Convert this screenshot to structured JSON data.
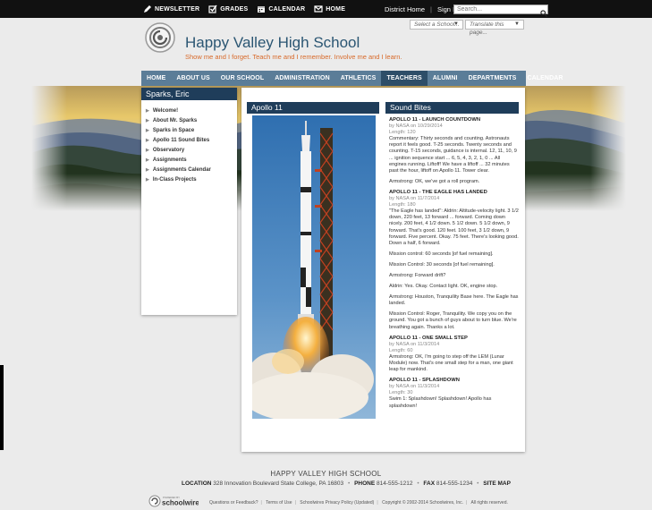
{
  "topbar": {
    "links": [
      {
        "label": "NEWSLETTER",
        "icon": "pencil-icon"
      },
      {
        "label": "GRADES",
        "icon": "checkbox-icon"
      },
      {
        "label": "CALENDAR",
        "icon": "calendar-icon"
      },
      {
        "label": "HOME",
        "icon": "home-icon"
      }
    ],
    "district_home": "District Home",
    "sign_in": "Sign In",
    "search_placeholder": "Search..."
  },
  "selectors": {
    "school": "Select a School...",
    "translate": "Translate this page..."
  },
  "header": {
    "school_name": "Happy Valley High School",
    "tagline": "Show me and I forget. Teach me and I remember. Involve me and I learn."
  },
  "nav": [
    "HOME",
    "ABOUT US",
    "OUR SCHOOL",
    "ADMINISTRATION",
    "ATHLETICS",
    "TEACHERS",
    "ALUMNI",
    "DEPARTMENTS",
    "CALENDAR"
  ],
  "nav_active": "TEACHERS",
  "sidebar": {
    "title": "Sparks, Eric",
    "items": [
      "Welcome!",
      "About Mr. Sparks",
      "Sparks in Space",
      "Apollo 11 Sound Bites",
      "Observatory",
      "Assignments",
      "Assignments Calendar",
      "In-Class Projects"
    ]
  },
  "apollo": {
    "title": "Apollo 11"
  },
  "sound_bites": {
    "title": "Sound Bites",
    "clips": [
      {
        "title": "APOLLO 11 - LAUNCH COUNTDOWN",
        "meta": "by NASA on 10/29/2014",
        "length": "Length: 120",
        "lines": [
          "Commentary: Thirty seconds and counting. Astronauts report it feels good. T-25 seconds. Twenty seconds and counting. T-15 seconds, guidance is internal. 12, 11, 10, 9 ... ignition sequence start ... 6, 5, 4, 3, 2, 1, 0 ... All engines running. Liftoff! We have a liftoff ... 32 minutes past the hour, liftoff on Apollo 11. Tower clear.",
          "Armstrong: OK, we've got a roll program."
        ]
      },
      {
        "title": "APOLLO 11 - THE EAGLE HAS LANDED",
        "meta": "by NASA on 11/7/2014",
        "length": "Length: 180",
        "lines": [
          "\"The Eagle has landed\": Aldrin: Altitude-velocity light. 3 1/2 down, 220 feet, 13 forward ... forward. Coming down nicely. 200 feet, 4 1/2 down. 5 1/2 down. 5 1/2 down, 9 forward. That's good. 120 feet. 100 feet, 3 1/2 down, 9 forward. Five percent. Okay. 75 feet. There's looking good. Down a half, 6 forward.",
          "Mission control: 60 seconds [of fuel remaining].",
          "Mission Control: 30 seconds [of fuel remaining].",
          "Armstrong: Forward drift?",
          "Aldrin: Yes. Okay. Contact light. OK, engine stop.",
          "Armstrong: Houston, Tranquility Base here. The Eagle has landed.",
          "Mission Control: Roger, Tranquility. We copy you on the ground. You got a bunch of guys about to turn blue. We're breathing again. Thanks a lot."
        ]
      },
      {
        "title": "APOLLO 11 - ONE SMALL STEP",
        "meta": "by NASA on 11/3/2014",
        "length": "Length: 60",
        "lines": [
          "Armstrong: OK, I'm going to step off the LEM (Lunar Module) now. That's one small step for a man, one giant leap for mankind."
        ]
      },
      {
        "title": "APOLLO 11 - SPLASHDOWN",
        "meta": "by NASA on 11/3/2014",
        "length": "Length: 30",
        "lines": [
          "Swim 1: Splashdown! Splashdown! Apollo has splashdown!"
        ]
      }
    ]
  },
  "footer": {
    "school": "HAPPY VALLEY HIGH SCHOOL",
    "location_label": "LOCATION",
    "location": "328 Innovation Boulevard State College, PA 16803",
    "phone_label": "PHONE",
    "phone": "814-555-1212",
    "fax_label": "FAX",
    "fax": "814-555-1234",
    "sitemap": "SITE MAP",
    "powered_by": "POWERED BY",
    "brand": "schoolwires",
    "links": [
      "Questions or Feedback?",
      "Terms of Use",
      "Schoolwires Privacy Policy (Updated)",
      "Copyright © 2002-2014 Schoolwires, Inc.",
      "All rights reserved."
    ]
  }
}
